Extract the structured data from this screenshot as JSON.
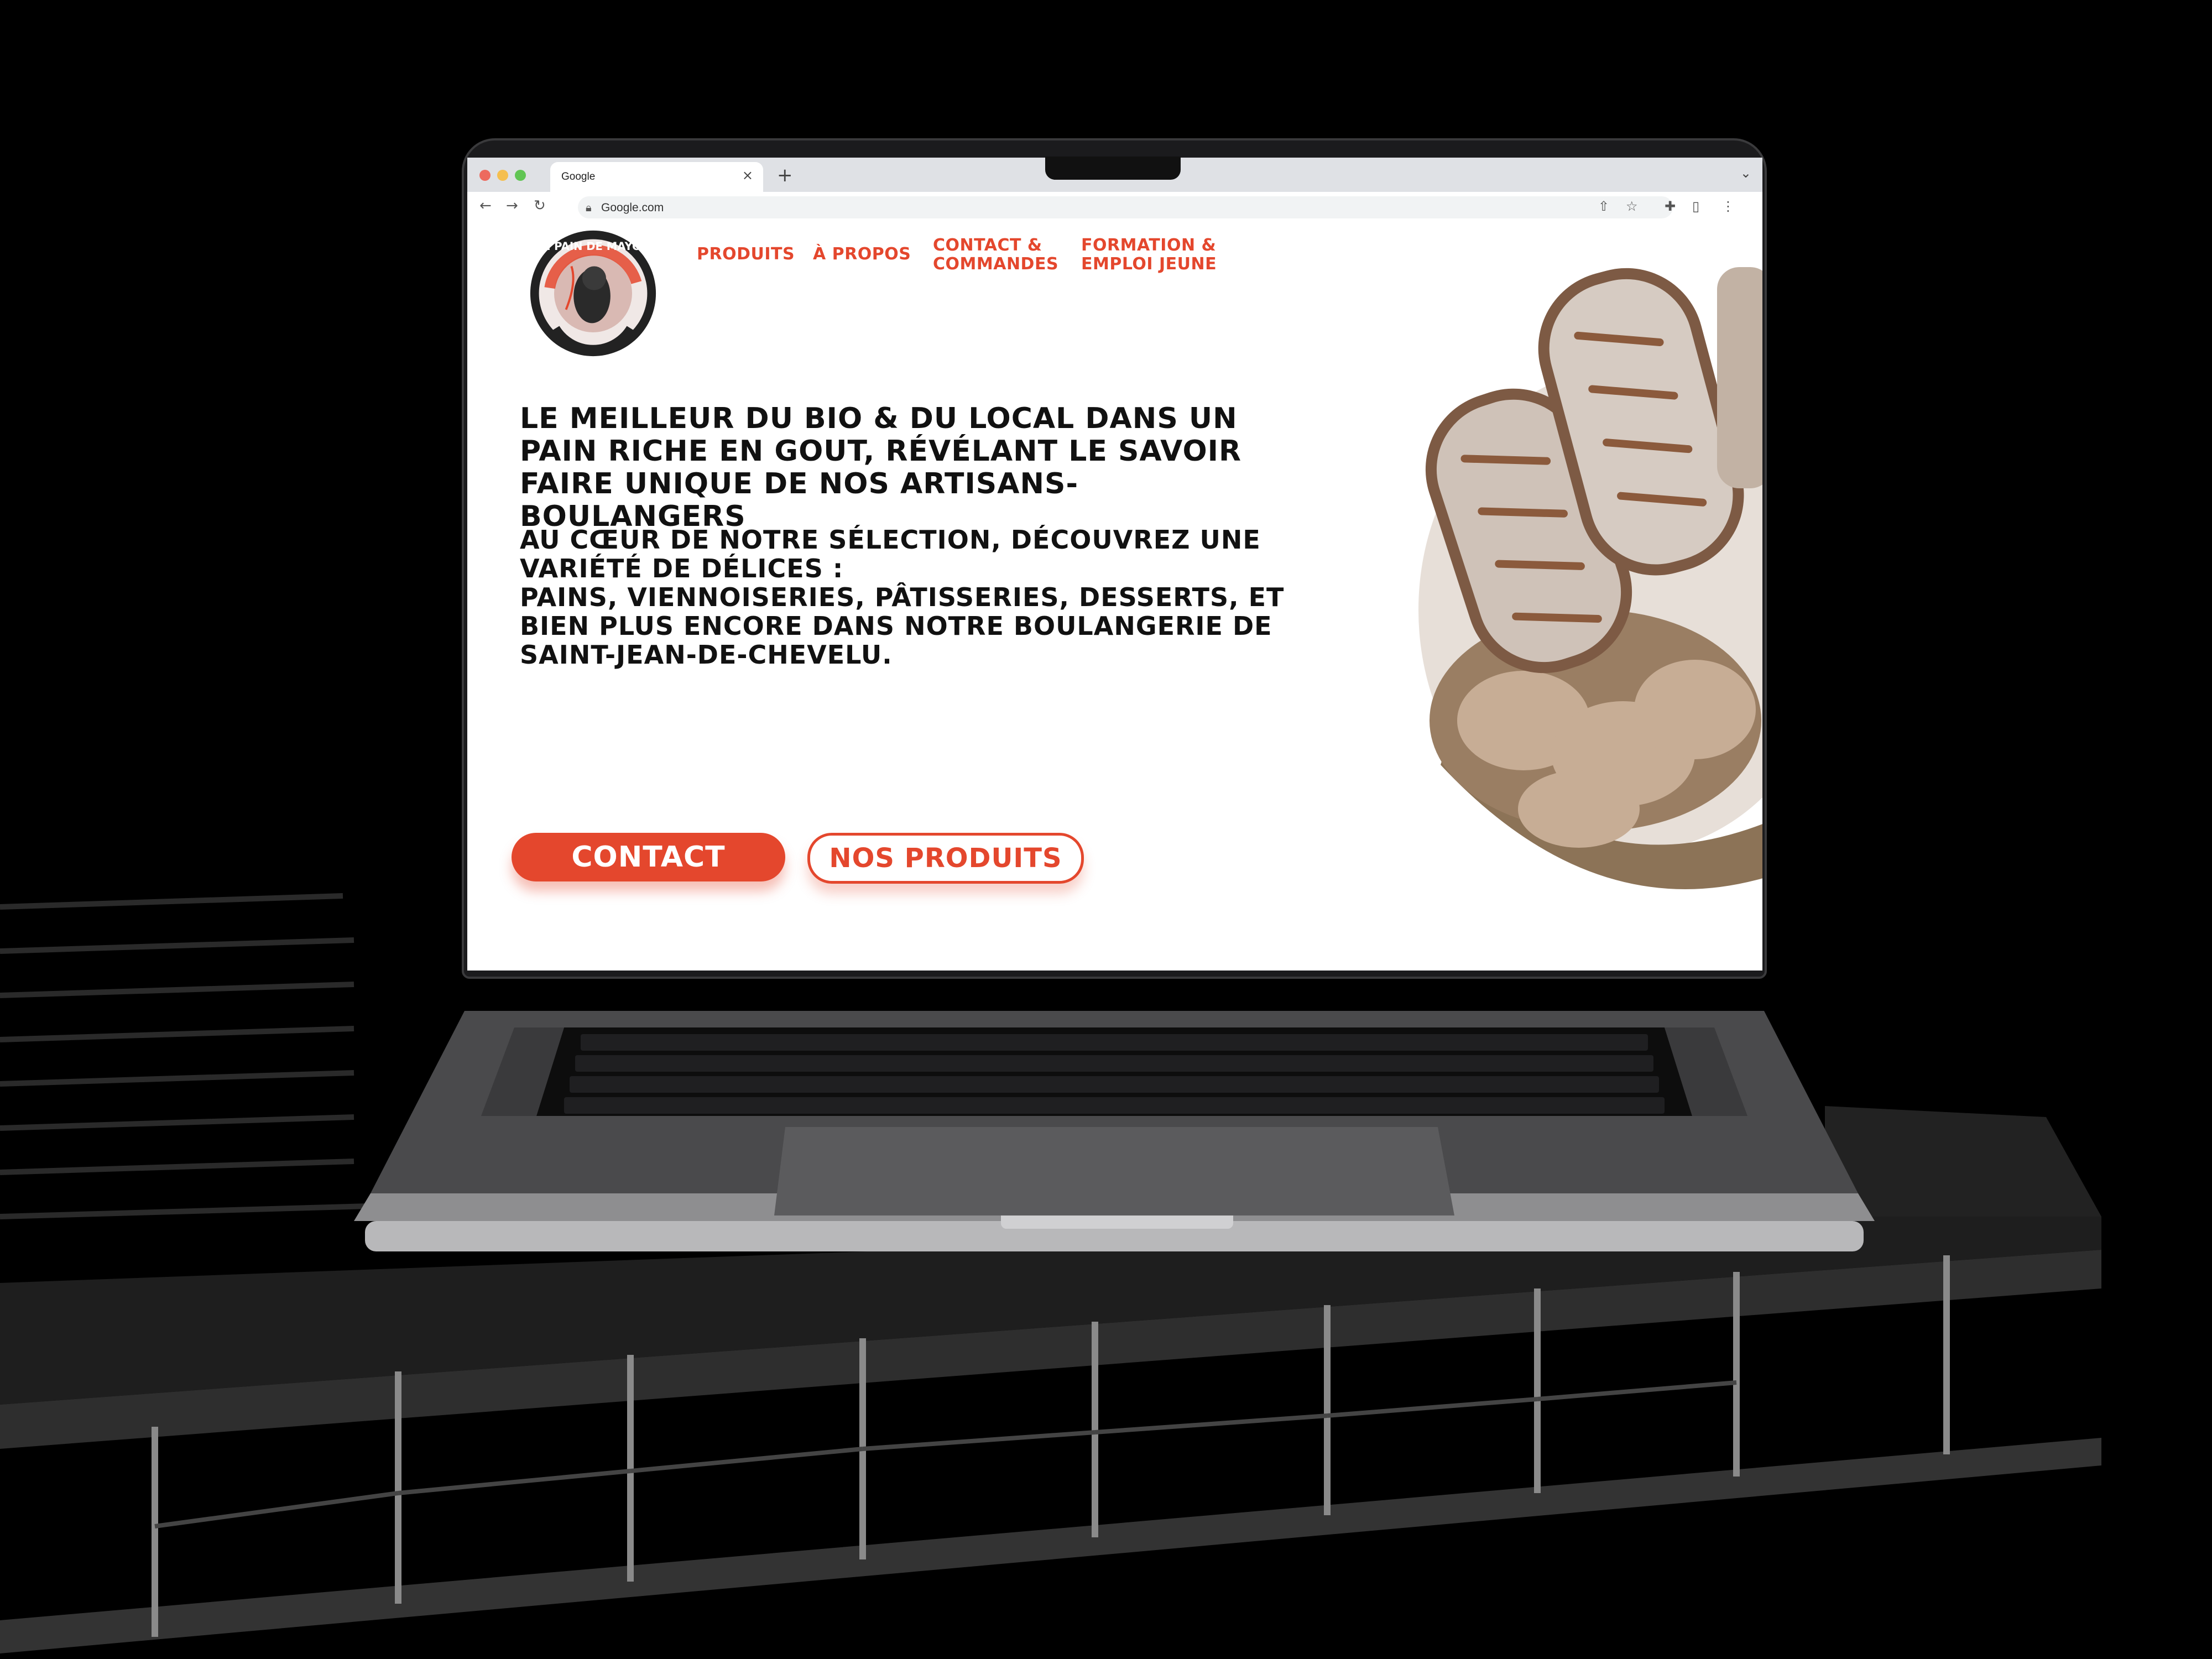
{
  "browser": {
    "tab_title": "Google",
    "tab_close": "×",
    "new_tab": "+",
    "tab_menu": "⌄",
    "url": "Google.com",
    "colors": {
      "close": "#ed6a5e",
      "minimize": "#f5bf4f",
      "maximize": "#61c554"
    }
  },
  "site": {
    "logo_alt": "Le Pain de Mayou",
    "nav": {
      "produits": "PRODUITS",
      "apropos": "À PROPOS",
      "contact": "CONTACT &\nCOMMANDES",
      "formation": "FORMATION &\nEMPLOI JEUNE"
    },
    "headline": "Le meilleur du bio & du local dans un pain riche en gout, révélant le savoir faire unique de nos artisans-boulangers",
    "paragraph": {
      "line1": "Au cœur de notre sélection, découvrez une variété de délices :",
      "line2": "Pains, viennoiseries, pâtisseries, desserts, et bien plus encore dans notre boulangerie de Saint-Jean-de-Chevelu."
    },
    "buttons": {
      "contact": "CONTACT",
      "produits": "NOS PRODUITS"
    },
    "accent": "#e4472d"
  }
}
